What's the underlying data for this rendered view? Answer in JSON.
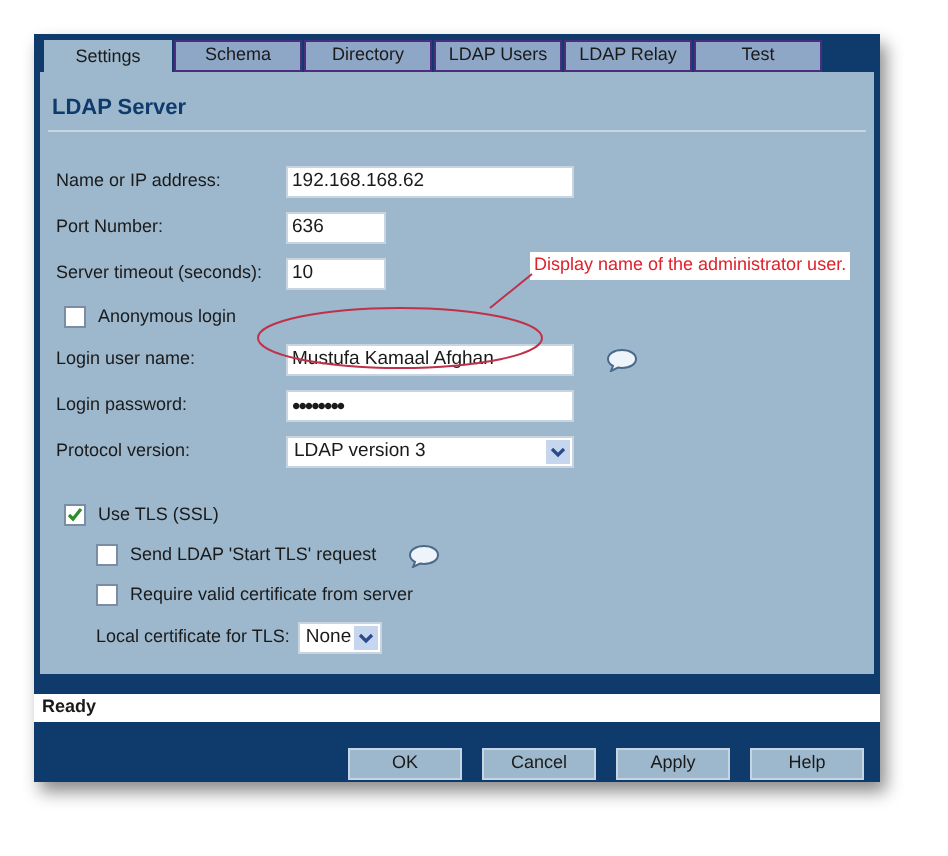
{
  "tabs": [
    {
      "label": "Settings",
      "selected": true
    },
    {
      "label": "Schema",
      "selected": false
    },
    {
      "label": "Directory",
      "selected": false
    },
    {
      "label": "LDAP Users",
      "selected": false
    },
    {
      "label": "LDAP Relay",
      "selected": false
    },
    {
      "label": "Test",
      "selected": false
    }
  ],
  "section_title": "LDAP Server",
  "fields": [
    {
      "kind": "text",
      "label": "Name or IP address:",
      "value": "192.168.168.62"
    },
    {
      "kind": "number",
      "label": "Port Number:",
      "value": "636"
    },
    {
      "kind": "number",
      "label": "Server timeout (seconds):",
      "value": "10"
    },
    {
      "kind": "checkbox",
      "label": "Anonymous login",
      "checked": false,
      "indent": false
    },
    {
      "kind": "text",
      "label": "Login user name:",
      "value": "Mustufa Kamaal Afghan",
      "help": true
    },
    {
      "kind": "password",
      "label": "Login password:",
      "value": "••••••••"
    },
    {
      "kind": "select",
      "label": "Protocol version:",
      "value": "LDAP version 3"
    },
    {
      "kind": "spacer"
    },
    {
      "kind": "checkbox",
      "label": "Use TLS (SSL)",
      "checked": true,
      "indent": false
    },
    {
      "kind": "checkbox",
      "label": "Send LDAP 'Start TLS' request",
      "checked": false,
      "indent": true,
      "help": true
    },
    {
      "kind": "checkbox",
      "label": "Require valid certificate from server",
      "checked": false,
      "indent": true
    },
    {
      "kind": "compact_select",
      "label": "Local certificate for TLS:",
      "value": "None"
    }
  ],
  "callout": "Display name of the administrator user.",
  "status_bar": "Ready",
  "buttons": [
    "OK",
    "Cancel",
    "Apply",
    "Help"
  ]
}
